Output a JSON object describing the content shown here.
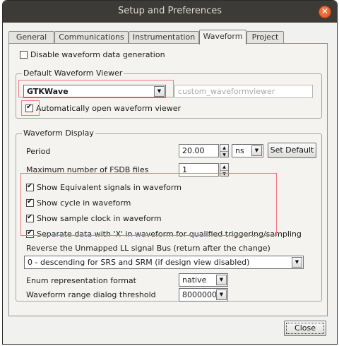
{
  "window": {
    "title": "Setup and Preferences"
  },
  "tabs": [
    {
      "label": "General"
    },
    {
      "label": "Communications"
    },
    {
      "label": "Instrumentation"
    },
    {
      "label": "Waveform"
    },
    {
      "label": "Project"
    }
  ],
  "active_tab": "Waveform",
  "disable_generation": {
    "label": "Disable waveform data generation",
    "checked": false
  },
  "viewer_group": {
    "title": "Default Waveform Viewer",
    "selected_viewer": "GTKWave",
    "custom_viewer_placeholder": "custom_waveformviewer",
    "auto_open": {
      "label": "Automatically open waveform viewer",
      "checked": true
    }
  },
  "display_group": {
    "title": "Waveform Display",
    "period": {
      "label": "Period",
      "value": "20.00",
      "unit": "ns",
      "set_default": "Set Default"
    },
    "max_fsdb": {
      "label": "Maximum number of FSDB files",
      "value": "1"
    },
    "options": [
      {
        "label": "Show Equivalent signals in waveform",
        "checked": true
      },
      {
        "label": "Show cycle in waveform",
        "checked": true
      },
      {
        "label": "Show sample clock in waveform",
        "checked": true
      },
      {
        "label": "Separate data with 'X' in waveform for  qualified triggering/sampling",
        "checked": true
      }
    ],
    "reverse_bus": {
      "label": "Reverse the Unmapped LL signal Bus (return after the change)",
      "selected": "0 - descending for SRS and SRM (if design view disabled)"
    },
    "enum_format": {
      "label": "Enum representation format",
      "selected": "native"
    },
    "range_threshold": {
      "label": "Waveform range dialog threshold",
      "selected": "8000000"
    }
  },
  "footer": {
    "close_label": "Close"
  },
  "colors": {
    "titlebar": "#3c3b37",
    "close_button": "#e95420",
    "highlight": "#ee7b82"
  }
}
